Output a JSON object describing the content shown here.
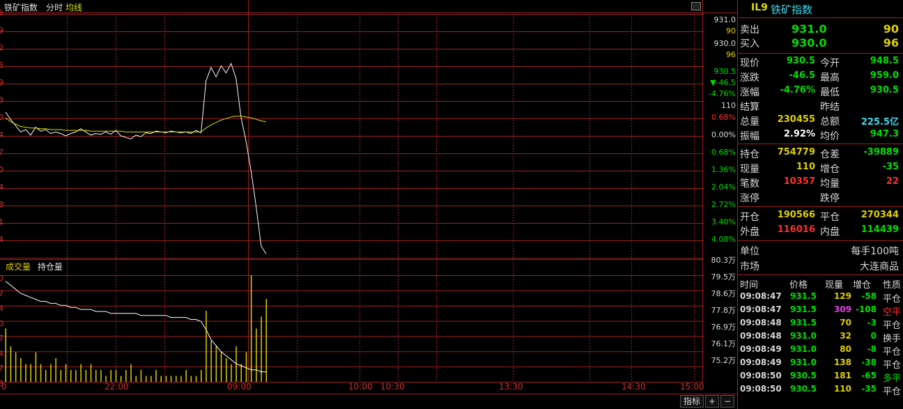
{
  "header": {
    "title": "铁矿指数",
    "tab_fenshi": "分时",
    "tab_junxian": "均线"
  },
  "price_scale_top": [
    "931.0",
    "90",
    "930.0",
    "96"
  ],
  "price_scale_mid": [
    "930.5",
    "▼-46.5",
    "-4.76%",
    "110"
  ],
  "pct_scale": [
    "0.68%",
    "0.00%",
    "0.68%",
    "1.36%",
    "2.04%",
    "2.72%",
    "3.40%",
    "4.08%"
  ],
  "vol_scale": [
    "80.3万",
    "79.5万",
    "78.6万",
    "77.8万",
    "76.9万",
    "76.1万",
    "75.2万"
  ],
  "left_digits_price": [
    "5",
    "9",
    "2",
    "5",
    "9",
    "3",
    "0",
    "4",
    "7",
    "0",
    "4",
    "8",
    "1",
    "4"
  ],
  "left_digits_vol": [
    "0",
    "7",
    "4",
    "0",
    "7",
    "4",
    "7",
    "3"
  ],
  "vol_legend": {
    "vol": "成交量",
    "oi": "持仓量"
  },
  "time_axis": [
    "0",
    "22:00",
    "09:00",
    "10:00",
    "10:30",
    "13:30",
    "14:30",
    "15:00"
  ],
  "bottom_buttons": {
    "zhibiao": "指标",
    "plus": "+",
    "minus": "−"
  },
  "panel": {
    "code": "IL9",
    "name": "铁矿指数",
    "sell_label": "卖出",
    "sell_price": "931.0",
    "sell_qty": "90",
    "buy_label": "买入",
    "buy_price": "930.0",
    "buy_qty": "96",
    "rows": [
      {
        "l1": "现价",
        "v1": "930.5",
        "c1": "#00e000",
        "l2": "今开",
        "v2": "948.5",
        "c2": "#00e000"
      },
      {
        "l1": "涨跌",
        "v1": "-46.5",
        "c1": "#00e000",
        "l2": "最高",
        "v2": "959.0",
        "c2": "#00e000"
      },
      {
        "l1": "涨幅",
        "v1": "-4.76%",
        "c1": "#00e000",
        "l2": "最低",
        "v2": "930.5",
        "c2": "#00e000"
      },
      {
        "l1": "结算",
        "v1": "",
        "c1": "#00e000",
        "l2": "昨结",
        "v2": "",
        "c2": "#00e000"
      },
      {
        "l1": "总量",
        "v1": "230455",
        "c1": "#e0d000",
        "l2": "总额",
        "v2": "225.5亿",
        "c2": "#40d8e8"
      },
      {
        "l1": "振幅",
        "v1": "2.92%",
        "c1": "#ffffff",
        "l2": "均价",
        "v2": "947.3",
        "c2": "#00e000"
      }
    ],
    "rows2": [
      {
        "l1": "持仓",
        "v1": "754779",
        "c1": "#e0d000",
        "l2": "仓差",
        "v2": "-39889",
        "c2": "#00e000"
      },
      {
        "l1": "现量",
        "v1": "110",
        "c1": "#e0d000",
        "l2": "增仓",
        "v2": "-35",
        "c2": "#00e000"
      },
      {
        "l1": "笔数",
        "v1": "10357",
        "c1": "#ff3030",
        "l2": "均量",
        "v2": "22",
        "c2": "#ff3030"
      },
      {
        "l1": "涨停",
        "v1": "",
        "c1": "#ff3030",
        "l2": "跌停",
        "v2": "",
        "c2": "#00e000"
      }
    ],
    "rows3": [
      {
        "l1": "开仓",
        "v1": "190566",
        "c1": "#e0d000",
        "l2": "平仓",
        "v2": "270344",
        "c2": "#e0d000"
      },
      {
        "l1": "外盘",
        "v1": "116016",
        "c1": "#ff3030",
        "l2": "内盘",
        "v2": "114439",
        "c2": "#00e000"
      }
    ],
    "unit_label": "单位",
    "unit_value": "每手100吨",
    "market_label": "市场",
    "market_value": "大连商品",
    "trade_headers": [
      "时间",
      "价格",
      "现量",
      "增仓",
      "性质"
    ],
    "trades": [
      {
        "t": "09:08:47",
        "p": "931.5",
        "q": "129",
        "qc": "#e0d000",
        "d": "-58",
        "n": "平仓",
        "nc": "#d8d8d8"
      },
      {
        "t": "09:08:47",
        "p": "931.5",
        "q": "309",
        "qc": "#e040e0",
        "d": "-108",
        "n": "空平",
        "nc": "#ff3030"
      },
      {
        "t": "09:08:48",
        "p": "931.5",
        "q": "70",
        "qc": "#e0d000",
        "d": "-3",
        "n": "平仓",
        "nc": "#d8d8d8"
      },
      {
        "t": "09:08:48",
        "p": "931.0",
        "q": "32",
        "qc": "#e0d000",
        "d": "0",
        "n": "换手",
        "nc": "#d8d8d8"
      },
      {
        "t": "09:08:49",
        "p": "931.0",
        "q": "80",
        "qc": "#e0d000",
        "d": "-8",
        "n": "平仓",
        "nc": "#d8d8d8"
      },
      {
        "t": "09:08:49",
        "p": "931.0",
        "q": "138",
        "qc": "#e0d000",
        "d": "-38",
        "n": "平仓",
        "nc": "#d8d8d8"
      },
      {
        "t": "09:08:50",
        "p": "930.5",
        "q": "181",
        "qc": "#e0d000",
        "d": "-65",
        "n": "多平",
        "nc": "#00e000"
      },
      {
        "t": "09:08:50",
        "p": "930.5",
        "q": "110",
        "qc": "#e0d000",
        "d": "-35",
        "n": "平仓",
        "nc": "#d8d8d8"
      }
    ]
  },
  "colors": {
    "grid": "#a02020",
    "price_line": "#ffffff",
    "avg_line": "#e0e000",
    "volume": "#e0d000",
    "oi_line": "#ffffff",
    "green": "#00e000",
    "red": "#ff3030"
  },
  "chart_data": {
    "type": "line",
    "series": [
      {
        "name": "价格",
        "values": [
          948.5,
          947.6,
          946.8,
          946.0,
          946.3,
          945.6,
          946.6,
          946.1,
          946.3,
          945.8,
          946.0,
          945.8,
          945.5,
          945.8,
          946.0,
          946.4,
          946.0,
          945.6,
          945.8,
          945.7,
          946.0,
          945.7,
          946.2,
          945.5,
          945.3,
          945.1,
          945.6,
          945.4,
          945.9,
          945.8,
          946.1,
          946.0,
          945.9,
          946.1,
          946.0,
          945.9,
          946.0,
          945.8,
          946.2,
          945.9,
          952.5,
          954.2,
          953.0,
          954.4,
          953.5,
          954.7,
          952.8,
          947.8,
          944.8,
          941.0,
          936.5,
          931.5,
          930.5
        ]
      },
      {
        "name": "均线",
        "values": [
          947.8,
          947.3,
          947.0,
          946.7,
          946.6,
          946.5,
          946.5,
          946.4,
          946.4,
          946.3,
          946.3,
          946.3,
          946.2,
          946.2,
          946.2,
          946.2,
          946.2,
          946.1,
          946.1,
          946.1,
          946.1,
          946.1,
          946.1,
          946.1,
          946.0,
          946.0,
          946.0,
          946.0,
          946.0,
          946.0,
          946.0,
          946.0,
          946.0,
          946.0,
          946.0,
          946.0,
          946.0,
          946.0,
          946.0,
          946.0,
          946.5,
          946.9,
          947.2,
          947.5,
          947.7,
          947.9,
          948.0,
          948.0,
          947.9,
          947.8,
          947.6,
          947.4,
          947.3
        ]
      },
      {
        "name": "持仓量",
        "values": [
          80.0,
          79.8,
          79.6,
          79.4,
          79.3,
          79.2,
          79.1,
          79.0,
          79.0,
          78.9,
          78.9,
          78.8,
          78.8,
          78.7,
          78.7,
          78.6,
          78.6,
          78.6,
          78.5,
          78.5,
          78.5,
          78.4,
          78.4,
          78.4,
          78.4,
          78.4,
          78.4,
          78.3,
          78.3,
          78.3,
          78.3,
          78.3,
          78.3,
          78.2,
          78.2,
          78.2,
          78.2,
          78.1,
          78.1,
          78.0,
          77.6,
          77.1,
          76.8,
          76.5,
          76.3,
          76.1,
          75.9,
          75.8,
          75.7,
          75.6,
          75.6,
          75.5,
          75.5
        ]
      },
      {
        "name": "成交量",
        "values": [
          9,
          6,
          5,
          4,
          3,
          3,
          5,
          3,
          2,
          3,
          4,
          2,
          3,
          2,
          2,
          3,
          2,
          3,
          2,
          2,
          1,
          2,
          2,
          1,
          2,
          3,
          1,
          2,
          1,
          1,
          2,
          1,
          1,
          1,
          1,
          1,
          2,
          1,
          1,
          2,
          12,
          7,
          6,
          5,
          4,
          3,
          6,
          3,
          5,
          18,
          9,
          11,
          14
        ]
      }
    ],
    "price_range": [
      930.0,
      961.0
    ],
    "oi_range": [
      75.0,
      80.3
    ]
  }
}
